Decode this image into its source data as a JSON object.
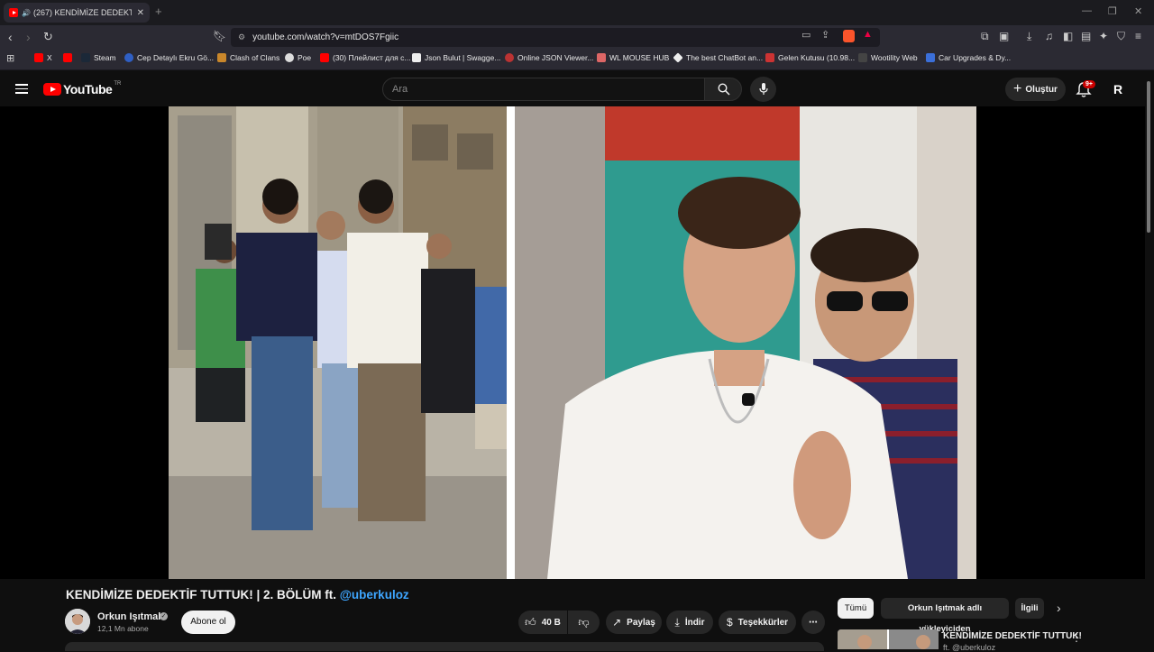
{
  "browser": {
    "tab_title": "(267) KENDİMİZE DEDEKTİF T...",
    "url": "youtube.com/watch?v=mtDOS7Fgiic",
    "bookmarks": [
      "X",
      "",
      "Steam",
      "Cep Detaylı Ekru Gö...",
      "Clash of Clans",
      "Poe",
      "(30) Плейлист для с...",
      "Json Bulut | Swagge...",
      "Online JSON Viewer...",
      "WL MOUSE HUB",
      "The best ChatBot an...",
      "Gelen Kutusu (10.98...",
      "Wootility Web",
      "Car Upgrades & Dy..."
    ]
  },
  "header": {
    "logo_text": "YouTube",
    "country_code": "TR",
    "search_placeholder": "Ara",
    "create_label": "Oluştur",
    "notification_count": "9+",
    "account_initial": "R"
  },
  "video": {
    "title_main": "KENDİMİZE DEDEKTİF TUTTUK! | 2. BÖLÜM ft. ",
    "title_mention": "@uberkuloz",
    "channel_name": "Orkun Işıtmak",
    "subscribers": "12,1 Mn abone",
    "subscribe_label": "Abone ol",
    "like_count": "40 B",
    "share_label": "Paylaş",
    "download_label": "İndir",
    "thanks_label": "Teşekkürler",
    "more_label": "⋯"
  },
  "sidebar": {
    "filters": [
      "Tümü",
      "Orkun Işıtmak adlı yükleyiciden",
      "İlgili"
    ],
    "recommendation": {
      "title": "KENDİMİZE DEDEKTİF TUTTUK!",
      "subtitle": "ft. @uberkuloz"
    }
  },
  "colors": {
    "youtube_red": "#ff0000",
    "link_blue": "#3ea6ff",
    "page_background": "#0f0f0f",
    "pill_background": "#272727"
  }
}
